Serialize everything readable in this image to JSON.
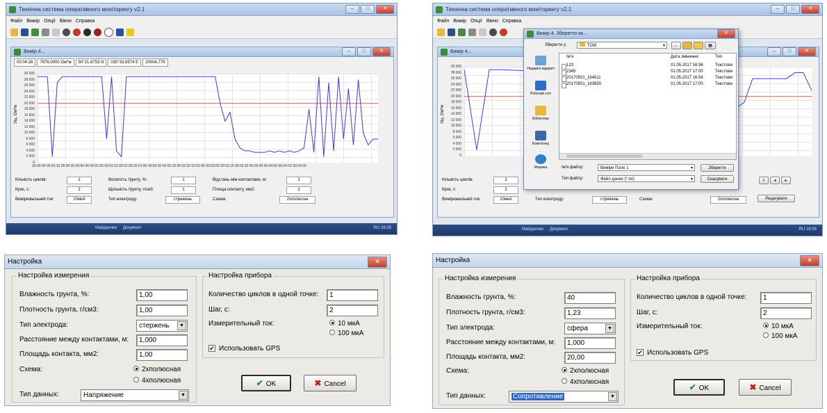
{
  "app": {
    "title": "Технічна система оперативного моніторингу v2.1",
    "menu": [
      "Файл",
      "Вимір",
      "Опції",
      "Вікно",
      "Справка"
    ],
    "inner_title": "Вимір 4...",
    "readout": [
      "00:04:28",
      "7876,0000 Ом*м",
      "50°21.6753 N",
      "030°33.8574 E",
      "20004,779"
    ],
    "ylabel": "Ущ. Ом*м",
    "yticks": [
      "30 000",
      "28 000",
      "26 000",
      "24 000",
      "22 000",
      "20 000",
      "18 000",
      "16 000",
      "14 000",
      "12 000",
      "10 000",
      "8 000",
      "6 000",
      "4 000",
      "2 000",
      "0"
    ],
    "xticks": "00:00:00 00:00:15 00:00:30 00:00:45 00:01:00 00:01:15 00:01:30 00:01:45 00:02:00 00:02:15 00:02:30 00:02:45 00:03:00 00:03:15 00:03:30 00:03:45 00:04:00 00:04:15 00:04:30",
    "stats": {
      "cycles_label": "Кількість циклів:",
      "cycles_value": "1",
      "step_label": "Крок, с:",
      "step_value": "2",
      "current_label": "Вимірювальний ток:",
      "current_value": "10мкА",
      "moisture_label": "Вологість ґрунту, %:",
      "moisture_value": "1",
      "density_label": "Щільність ґрунту, г/см3:",
      "density_value": "1",
      "electrode_label": "Тип електроду:",
      "electrode_value": "стрижень",
      "distance_label": "Відстань між контактами, м:",
      "distance_value": "1",
      "area_label": "Площа контакту, мм2:",
      "area_value": "1",
      "scheme_label": "Схема:",
      "scheme_value": "2хполюсна"
    },
    "taskbar": [
      "Майданчик",
      "Документ"
    ],
    "taskbar_right": "RU 16:05",
    "dialog": {
      "title": "Вимір 4. Зберегти як...",
      "save_in_label": "Зберегти у:",
      "save_in_value": "TOM",
      "col_name": "Ім'я",
      "col_date": "Дата змінення",
      "col_type": "Тип",
      "files": [
        {
          "name": "123",
          "date": "01.05.2017 16:36",
          "type": "Текстови"
        },
        {
          "name": "2345",
          "date": "01.05.2017 17:00",
          "type": "Текстови"
        },
        {
          "name": "20170501_164511",
          "date": "01.05.2017 16:56",
          "type": "Текстови"
        },
        {
          "name": "20170501_163655",
          "date": "01.05.2017 17:00",
          "type": "Текстови"
        }
      ],
      "places": [
        "Недавно відкриті",
        "Робочий стіл",
        "Бібліотеки",
        "Комп'ютер",
        "Мережа"
      ],
      "filename_label": "Ім'я файлу:",
      "filename_value": "Виміри Поле 1",
      "filetype_label": "Тип файлу:",
      "filetype_value": "Файл даних (*.txt)",
      "save_btn": "Зберегти",
      "cancel_btn": "Скасувати",
      "edit_btn": "Редагувати"
    }
  },
  "settings_left": {
    "title": "Настройка",
    "group_measure": "Настройка измерения",
    "group_device": "Настройка прибора",
    "moisture_label": "Влажность грунта, %:",
    "moisture_value": "1,00",
    "density_label": "Плотность грунта, г/см3:",
    "density_value": "1,00",
    "electrode_label": "Тип электрода:",
    "electrode_value": "стержень",
    "distance_label": "Расстояние между контактами, м:",
    "distance_value": "1,000",
    "area_label": "Площадь контакта, мм2:",
    "area_value": "1,00",
    "scheme_label": "Схема:",
    "scheme_opt1": "2хполюсная",
    "scheme_opt2": "4хполюсная",
    "datatype_label": "Тип данных:",
    "datatype_value": "Напряжение",
    "cycles_label": "Количество циклов в одной точке:",
    "cycles_value": "1",
    "step_label": "Шаг, с:",
    "step_value": "2",
    "current_label": "Измерительный ток:",
    "current_opt1": "10 мкА",
    "current_opt2": "100 мкА",
    "gps_label": "Использовать GPS",
    "ok_label": "OK",
    "cancel_label": "Cancel"
  },
  "settings_right": {
    "title": "Настройка",
    "group_measure": "Настройка измерения",
    "group_device": "Настройка прибора",
    "moisture_label": "Влажность грунта, %:",
    "moisture_value": "40",
    "density_label": "Плотность грунта, г/см3:",
    "density_value": "1,23",
    "electrode_label": "Тип электрода:",
    "electrode_value": "сфера",
    "distance_label": "Расстояние между контактами, м:",
    "distance_value": "1,000",
    "area_label": "Площадь контакта, мм2:",
    "area_value": "20,00",
    "scheme_label": "Схема:",
    "scheme_opt1": "2хполюсная",
    "scheme_opt2": "4хполюсная",
    "datatype_label": "Тип данных:",
    "datatype_value": "Сопротивление",
    "cycles_label": "Количество циклов в одной точке:",
    "cycles_value": "1",
    "step_label": "Шаг, с:",
    "step_value": "2",
    "current_label": "Измерительный ток:",
    "current_opt1": "10 мкА",
    "current_opt2": "100 мкА",
    "gps_label": "Использовать GPS",
    "ok_label": "OK",
    "cancel_label": "Cancel"
  },
  "chart_data": [
    {
      "type": "line",
      "ylabel": "Ущ. Ом*м",
      "ylim": [
        0,
        30000
      ],
      "threshold": 20000,
      "x_seconds": [
        0,
        8,
        12,
        16,
        20,
        24,
        28,
        32,
        36,
        40,
        44,
        48,
        52,
        56,
        60,
        64,
        68,
        72,
        76,
        80,
        84,
        88,
        92,
        96,
        100,
        104,
        108,
        112,
        116,
        120,
        124,
        128,
        132,
        136,
        140,
        144,
        148,
        152,
        156,
        160,
        164,
        168,
        172,
        176,
        180,
        184,
        188,
        192,
        196,
        200,
        204,
        208,
        212,
        216,
        220,
        224,
        228,
        232,
        236,
        240,
        244,
        248,
        252,
        256,
        260,
        264,
        268,
        272,
        276
      ],
      "values": [
        29000,
        29000,
        2000,
        27000,
        29000,
        29000,
        29000,
        29000,
        29000,
        29000,
        29000,
        29000,
        29000,
        8000,
        29000,
        4000,
        2000,
        29000,
        29000,
        29000,
        29000,
        29000,
        29000,
        29000,
        29000,
        29000,
        29000,
        29000,
        29000,
        29000,
        29000,
        29000,
        29000,
        29000,
        29000,
        29000,
        20000,
        14000,
        17000,
        8000,
        5000,
        4000,
        4000,
        3500,
        3500,
        3500,
        4000,
        3500,
        4000,
        3500,
        4000,
        3500,
        4000,
        5000,
        18000,
        3500,
        29000,
        2000,
        27000,
        4000,
        29000,
        8000,
        25000,
        6000,
        28000,
        10000,
        6000,
        8000,
        8000
      ]
    },
    {
      "type": "line",
      "ylim": [
        0,
        30000
      ],
      "threshold": 20000,
      "partial": true,
      "values": [
        29000,
        2000,
        29000,
        29000,
        26000,
        22000,
        18000,
        16000,
        14000,
        16000,
        18000,
        26000,
        26000,
        26000,
        26000,
        26000,
        28000,
        28000,
        22000
      ]
    }
  ]
}
